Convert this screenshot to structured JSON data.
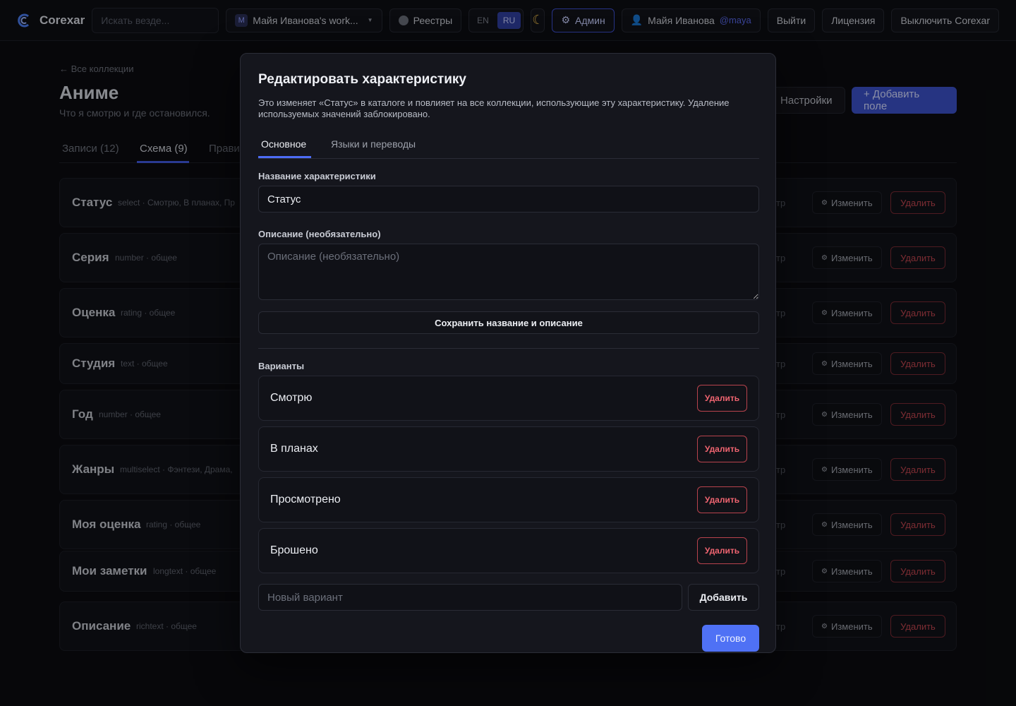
{
  "topbar": {
    "app_name": "Corexar",
    "search_placeholder": "Искать везде...",
    "workspace_badge": "M",
    "workspace_label": "Майя Иванова's work...",
    "registries_label": "Реестры",
    "lang_en": "EN",
    "lang_ru": "RU",
    "theme_icon": "☾",
    "admin_label": "Админ",
    "user_name": "Майя Иванова",
    "user_handle": "@maya",
    "logout_label": "Выйти",
    "license_label": "Лицензия",
    "disable_label": "Выключить Corexar"
  },
  "page": {
    "back_link": "← Все коллекции",
    "title": "Аниме",
    "subtitle": "Что я смотрю и где остановился.",
    "settings_label": "Настройки",
    "add_field_label": "+ Добавить поле",
    "tabs": [
      "Записи (12)",
      "Схема (9)",
      "Прави"
    ],
    "edit_label": "Изменить",
    "delete_label": "Удалить",
    "tr_label": "тр",
    "fields": [
      {
        "name": "Статус",
        "meta": "select · Смотрю, В планах, Пр"
      },
      {
        "name": "Серия",
        "meta": "number · общее"
      },
      {
        "name": "Оценка",
        "meta": "rating · общее"
      },
      {
        "name": "Студия",
        "meta": "text · общее"
      },
      {
        "name": "Год",
        "meta": "number · общее"
      },
      {
        "name": "Жанры",
        "meta": "multiselect · Фэнтези, Драма,"
      },
      {
        "name": "Моя оценка",
        "meta": "rating · общее"
      },
      {
        "name": "Мои заметки",
        "meta": "longtext · общее"
      },
      {
        "name": "Описание",
        "meta": "richtext · общее"
      }
    ]
  },
  "modal": {
    "title": "Редактировать характеристику",
    "description": "Это изменяет «Статус» в каталоге и повлияет на все коллекции, использующие эту характеристику. Удаление используемых значений заблокировано.",
    "tab_main": "Основное",
    "tab_langs": "Языки и переводы",
    "name_label": "Название характеристики",
    "name_value": "Статус",
    "desc_label": "Описание (необязательно)",
    "desc_placeholder": "Описание (необязательно)",
    "save_label": "Сохранить название и описание",
    "options_label": "Варианты",
    "options": [
      "Смотрю",
      "В планах",
      "Просмотрено",
      "Брошено"
    ],
    "option_delete_label": "Удалить",
    "new_option_placeholder": "Новый вариант",
    "add_label": "Добавить",
    "done_label": "Готово"
  }
}
